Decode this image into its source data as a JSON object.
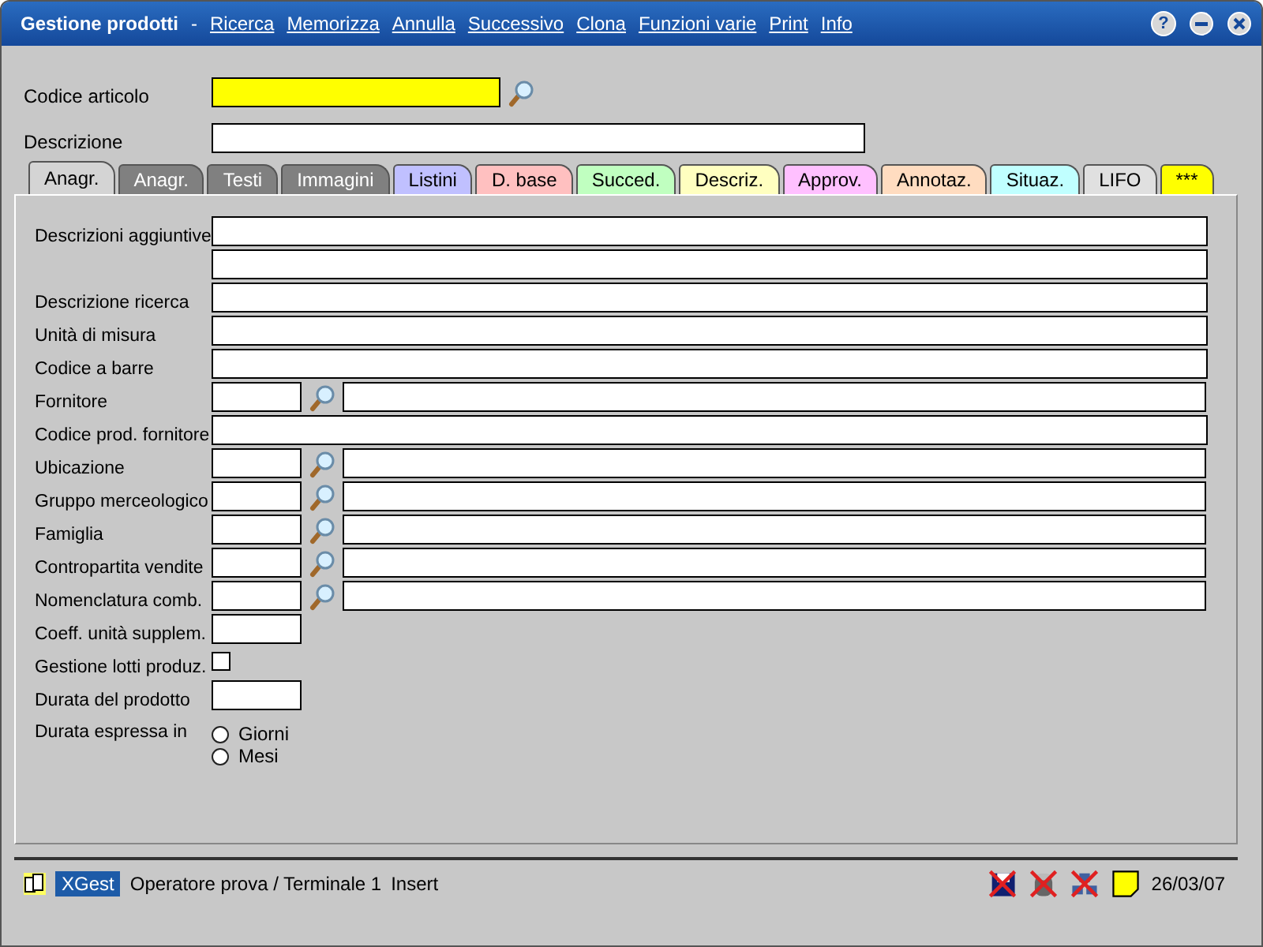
{
  "window": {
    "title": "Gestione prodotti",
    "separator": "-"
  },
  "menu": [
    "Ricerca",
    "Memorizza",
    "Annulla",
    "Successivo",
    "Clona",
    "Funzioni varie",
    "Print",
    "Info"
  ],
  "window_buttons": [
    "?"
  ],
  "header": [
    {
      "label": "Codice articolo",
      "kind": "code"
    },
    {
      "label": "Descrizione",
      "kind": "wide"
    }
  ],
  "tabs": [
    {
      "label": "Anagr.",
      "color": "#d4d4d4",
      "selected": true
    },
    {
      "label": "Anagr.",
      "color": "#808080",
      "selected": false
    },
    {
      "label": "Testi",
      "color": "#808080",
      "selected": false
    },
    {
      "label": "Immagini",
      "color": "#808080",
      "selected": false
    },
    {
      "label": "Listini",
      "color": "#c0c0ff",
      "selected": false
    },
    {
      "label": "D. base",
      "color": "#ffc0c0",
      "selected": false
    },
    {
      "label": "Succed.",
      "color": "#c0ffc0",
      "selected": false
    },
    {
      "label": "Descriz.",
      "color": "#ffffc0",
      "selected": false
    },
    {
      "label": "Approv.",
      "color": "#ffc0ff",
      "selected": false
    },
    {
      "label": "Annotaz.",
      "color": "#ffdcc0",
      "selected": false
    },
    {
      "label": "Situaz.",
      "color": "#c0ffff",
      "selected": false
    },
    {
      "label": "LIFO",
      "color": "#e0e0e0",
      "selected": false
    },
    {
      "label": "***",
      "color": "#ffff00",
      "selected": false
    }
  ],
  "fields": [
    {
      "label": "Descrizioni aggiuntive",
      "kind": "text"
    },
    {
      "kind": "text"
    },
    {
      "label": "Descrizione ricerca",
      "kind": "text"
    },
    {
      "label": "Unità di misura",
      "kind": "text"
    },
    {
      "label": "Codice a barre",
      "kind": "text"
    },
    {
      "label": "Fornitore",
      "kind": "lookup"
    },
    {
      "label": "Codice prod. fornitore",
      "kind": "text"
    },
    {
      "label": "Ubicazione",
      "kind": "lookup"
    },
    {
      "label": "Gruppo merceologico",
      "kind": "lookup"
    },
    {
      "label": "Famiglia",
      "kind": "lookup"
    },
    {
      "label": "Contropartita vendite",
      "kind": "lookup"
    },
    {
      "label": "Nomenclatura comb.",
      "kind": "lookup"
    },
    {
      "label": "Coeff. unità supplem.",
      "kind": "short"
    },
    {
      "label": "Gestione lotti produz.",
      "kind": "checkbox",
      "checked": false
    },
    {
      "label": "Durata del prodotto",
      "kind": "short"
    },
    {
      "label": "Durata espressa in",
      "kind": "radio",
      "options": [
        {
          "label": "Giorni",
          "selected": false
        },
        {
          "label": "Mesi",
          "selected": false
        }
      ]
    }
  ],
  "status_bar": {
    "app": "XGest",
    "operator": "Operatore prova / Terminale 1",
    "mode": "Insert",
    "date": "26/03/07"
  }
}
